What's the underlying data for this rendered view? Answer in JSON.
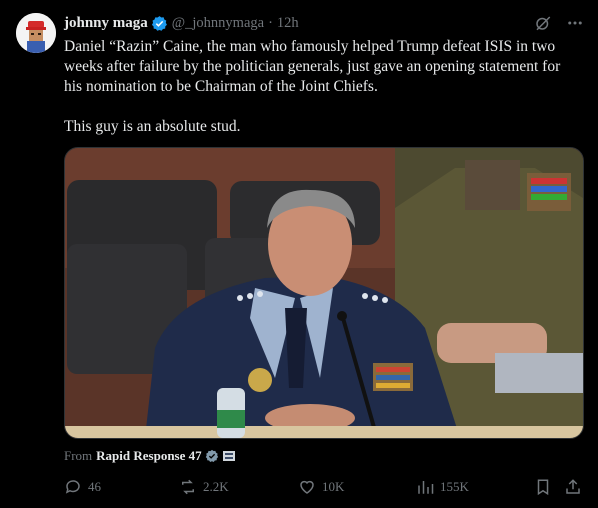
{
  "post": {
    "display_name": "johnny maga",
    "handle": "@_johnnymaga",
    "separator": "·",
    "time": "12h",
    "text": "Daniel “Razin” Caine, the man who famously helped Trump defeat ISIS in two weeks after failure by the politician generals, just gave an opening statement for his nomination to be Chairman of the Joint Chiefs.\n\nThis guy is an absolute stud.",
    "from_prefix": "From",
    "from_source": "Rapid Response 47"
  },
  "actions": {
    "replies": "46",
    "reposts": "2.2K",
    "likes": "10K",
    "views": "155K"
  },
  "colors": {
    "background": "#000000",
    "text": "#e7e9ea",
    "muted": "#71767b",
    "verified": "#1d9bf0"
  },
  "icons": [
    "verified-badge-icon",
    "grok-icon",
    "more-icon",
    "affiliate-badge-icon",
    "reply-icon",
    "repost-icon",
    "like-icon",
    "views-icon",
    "bookmark-icon",
    "share-icon"
  ]
}
